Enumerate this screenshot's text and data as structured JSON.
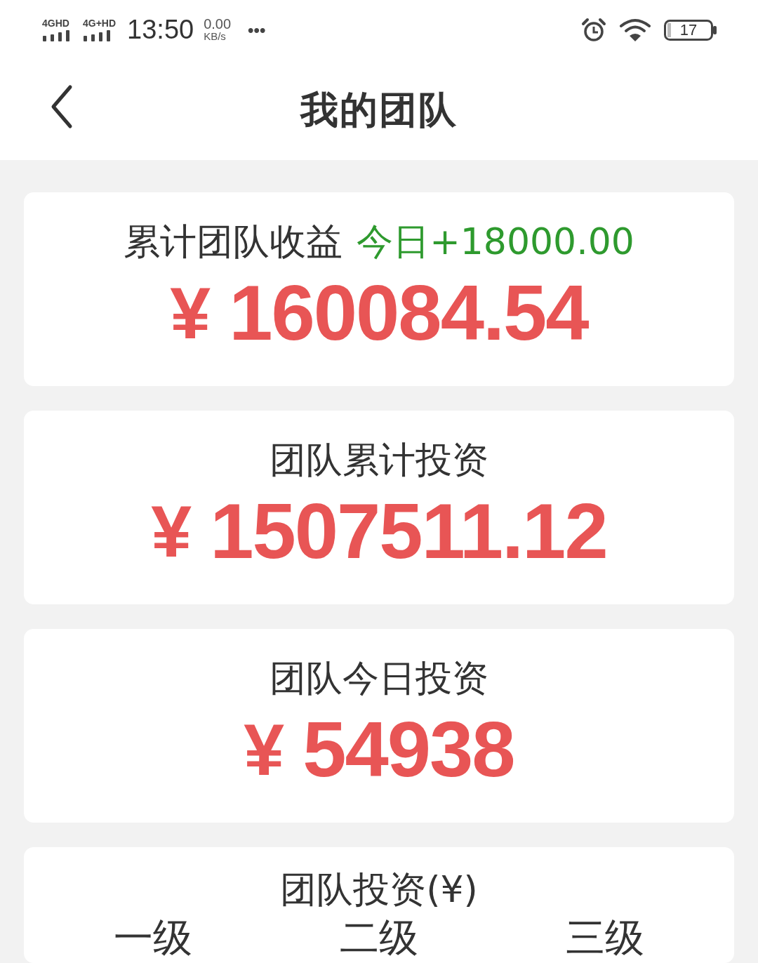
{
  "status_bar": {
    "networks": [
      "4GHD",
      "4G+HD"
    ],
    "time": "13:50",
    "speed_value": "0.00",
    "speed_unit": "KB/s",
    "more": "•••",
    "battery": "17"
  },
  "header": {
    "title": "我的团队"
  },
  "summary_cards": [
    {
      "label": "累计团队收益",
      "today": "今日+18000.00",
      "currency": "¥",
      "amount": "160084.54"
    },
    {
      "label": "团队累计投资",
      "currency": "¥",
      "amount": "1507511.12"
    },
    {
      "label": "团队今日投资",
      "currency": "¥",
      "amount": "54938"
    }
  ],
  "team_investment": {
    "title": "团队投资(¥)",
    "levels": [
      "一级",
      "二级",
      "三级"
    ]
  }
}
